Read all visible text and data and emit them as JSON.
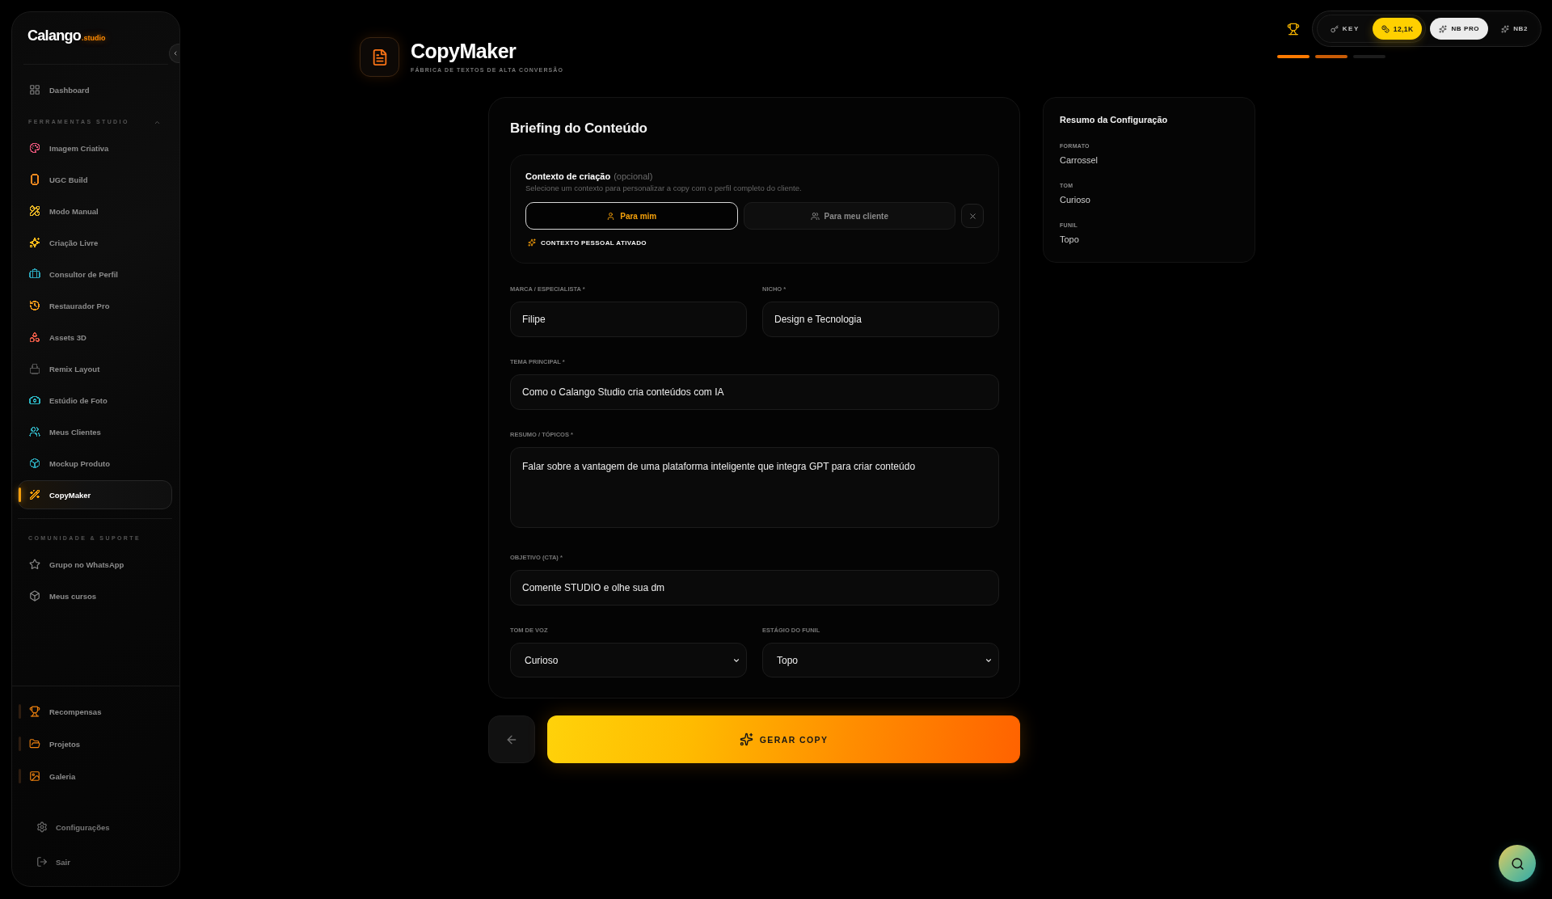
{
  "sidebar": {
    "logo": {
      "wordmark": "Calango",
      "suffix": ".studio"
    },
    "main_items": [
      {
        "label": "Dashboard",
        "selected": false
      }
    ],
    "sections": [
      {
        "title": "FERRAMENTAS STUDIO",
        "expanded": true,
        "items": [
          {
            "label": "Imagem Criativa",
            "color": "#e8557a",
            "selected": false
          },
          {
            "label": "UGC Build",
            "color": "#f58a1f",
            "selected": false
          },
          {
            "label": "Modo Manual",
            "color": "#e7b525",
            "selected": false
          },
          {
            "label": "Criação Livre",
            "color": "#f5b91a",
            "selected": false
          },
          {
            "label": "Consultor de Perfil",
            "color": "#2ba4b8",
            "selected": false
          },
          {
            "label": "Restaurador Pro",
            "color": "#f29a1a",
            "selected": false
          },
          {
            "label": "Assets 3D",
            "color": "#e25845",
            "selected": false
          },
          {
            "label": "Remix Layout",
            "color": "#4e4e4e",
            "selected": false
          },
          {
            "label": "Estúdio de Foto",
            "color": "#2bb3c0",
            "selected": false
          },
          {
            "label": "Meus Clientes",
            "color": "#2ea7b5",
            "selected": false
          },
          {
            "label": "Mockup Produto",
            "color": "#2a9fb0",
            "selected": false
          },
          {
            "label": "CopyMaker",
            "color": "#f59e0b",
            "selected": true
          }
        ]
      },
      {
        "title": "COMUNIDADE & SUPORTE",
        "items": [
          {
            "label": "Grupo no WhatsApp",
            "selected": false
          },
          {
            "label": "Meus cursos",
            "selected": false
          }
        ]
      }
    ],
    "bottom_items": [
      {
        "label": "Recompensas",
        "selected": false
      },
      {
        "label": "Projetos",
        "selected": false
      },
      {
        "label": "Galeria",
        "selected": false
      }
    ],
    "footer_items": [
      {
        "label": "Configurações"
      },
      {
        "label": "Sair"
      }
    ]
  },
  "header": {
    "title": "CopyMaker",
    "subtitle": "FÁBRICA DE TEXTOS DE ALTA CONVERSÃO"
  },
  "topbar": {
    "key_button": {
      "label": "KEY"
    },
    "credits": {
      "label": "12,1K"
    },
    "models": [
      {
        "label": "NB PRO",
        "selected": true
      },
      {
        "label": "NB2",
        "selected": false
      }
    ],
    "steps": [
      {
        "color": "#ff7a00"
      },
      {
        "color": "#c95c06"
      },
      {
        "color": "#1c1c1c"
      }
    ]
  },
  "briefing": {
    "title": "Briefing do Conteúdo",
    "context": {
      "title": "Contexto de criação",
      "note": "(opcional)",
      "description": "Selecione um contexto para personalizar a copy com o perfil completo do cliente.",
      "options": [
        {
          "label": "Para mim",
          "selected": true
        },
        {
          "label": "Para meu cliente",
          "selected": false
        }
      ],
      "status": "CONTEXTO PESSOAL ATIVADO"
    },
    "rows": [
      {
        "fields": [
          {
            "kind": "input",
            "label": "MARCA / ESPECIALISTA *",
            "value": "Filipe"
          },
          {
            "kind": "input",
            "label": "NICHO *",
            "value": "Design e Tecnologia"
          }
        ]
      },
      {
        "fields": [
          {
            "kind": "input",
            "label": "TEMA PRINCIPAL *",
            "value": "Como o Calango Studio cria conteúdos com IA"
          }
        ]
      },
      {
        "fields": [
          {
            "kind": "textarea",
            "label": "RESUMO / TÓPICOS *",
            "value": "Falar sobre a vantagem de uma plataforma inteligente que integra GPT para criar conteúdo"
          }
        ]
      },
      {
        "fields": [
          {
            "kind": "input",
            "label": "OBJETIVO (CTA) *",
            "value": "Comente STUDIO e olhe sua dm"
          }
        ]
      },
      {
        "fields": [
          {
            "kind": "select",
            "label": "TOM DE VOZ",
            "value": "Curioso"
          },
          {
            "kind": "select",
            "label": "ESTÁGIO DO FUNIL",
            "value": "Topo"
          }
        ]
      }
    ]
  },
  "actions": {
    "generate": {
      "label": "GERAR COPY"
    }
  },
  "summary": {
    "title": "Resumo da Configuração",
    "items": [
      {
        "label": "FORMATO",
        "value": "Carrossel"
      },
      {
        "label": "TOM",
        "value": "Curioso"
      },
      {
        "label": "FUNIL",
        "value": "Topo"
      }
    ]
  }
}
